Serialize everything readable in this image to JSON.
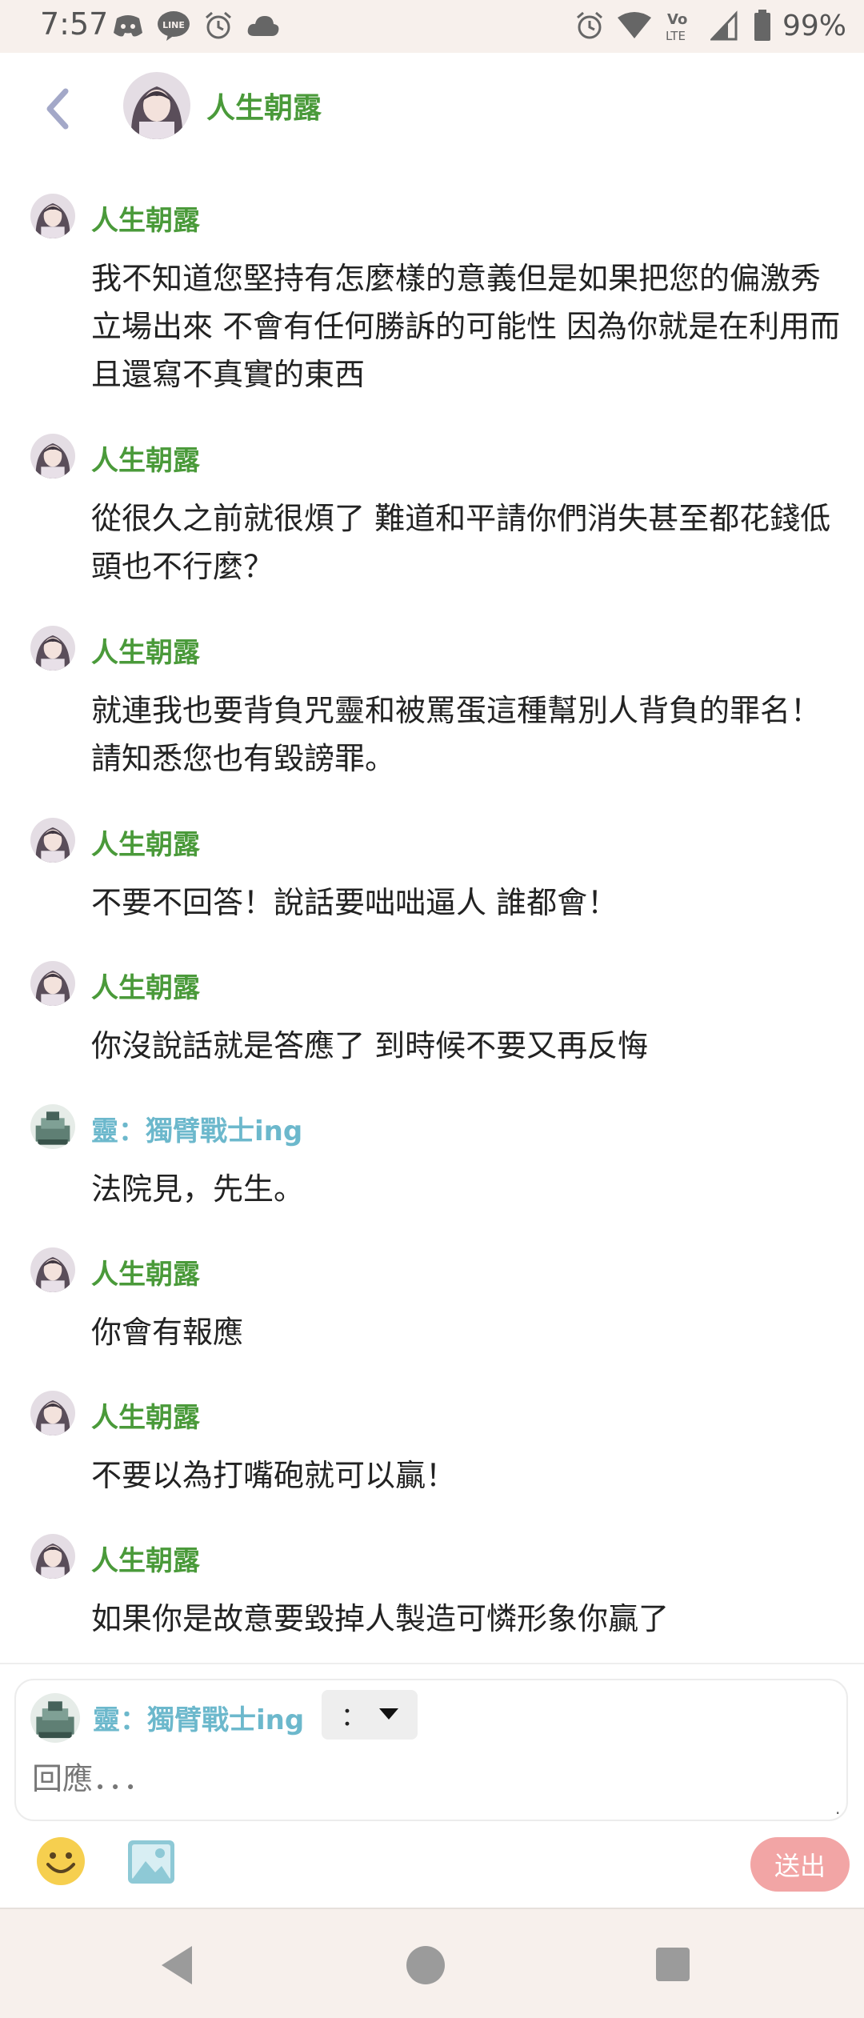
{
  "status_bar": {
    "time": "7:57",
    "battery": "99%",
    "icons_left": [
      "discord-icon",
      "line-icon",
      "alarm-icon",
      "cloud-icon"
    ],
    "icons_right": [
      "alarm-icon",
      "wifi-icon",
      "volte-icon",
      "signal-icon",
      "battery-icon"
    ]
  },
  "header": {
    "title": "人生朝露",
    "avatar": "anime-girl-avatar"
  },
  "messages": [
    {
      "author": "人生朝露",
      "author_color": "#4a9a3a",
      "avatar": "anime-girl-avatar",
      "text": "我不知道您堅持有怎麼樣的意義但是如果把您的偏激秀立場出來 不會有任何勝訴的可能性 因為你就是在利用而且還寫不真實的東西"
    },
    {
      "author": "人生朝露",
      "author_color": "#4a9a3a",
      "avatar": "anime-girl-avatar",
      "text": "從很久之前就很煩了 難道和平請你們消失甚至都花錢低頭也不行麼？"
    },
    {
      "author": "人生朝露",
      "author_color": "#4a9a3a",
      "avatar": "anime-girl-avatar",
      "text": "就連我也要背負咒靈和被罵蛋這種幫別人背負的罪名！請知悉您也有毀謗罪。"
    },
    {
      "author": "人生朝露",
      "author_color": "#4a9a3a",
      "avatar": "anime-girl-avatar",
      "text": "不要不回答！說話要咄咄逼人 誰都會！"
    },
    {
      "author": "人生朝露",
      "author_color": "#4a9a3a",
      "avatar": "anime-girl-avatar",
      "text": "你沒說話就是答應了 到時候不要又再反悔"
    },
    {
      "author": "靈：獨臂戰士ing",
      "author_color": "#6cb8cc",
      "avatar": "pixel-warrior-avatar",
      "text": "法院見，先生。"
    },
    {
      "author": "人生朝露",
      "author_color": "#4a9a3a",
      "avatar": "anime-girl-avatar",
      "text": "你會有報應"
    },
    {
      "author": "人生朝露",
      "author_color": "#4a9a3a",
      "avatar": "anime-girl-avatar",
      "text": "不要以為打嘴砲就可以贏！"
    },
    {
      "author": "人生朝露",
      "author_color": "#4a9a3a",
      "avatar": "anime-girl-avatar",
      "text": "如果你是故意要毀掉人製造可憐形象你贏了"
    }
  ],
  "composer": {
    "identity_name": "靈：獨臂戰士ing",
    "dropdown_label": "：",
    "placeholder": "回應．．．",
    "send_label": "送出",
    "send_color": "#f2a5a5"
  },
  "colors": {
    "accent_green": "#4a9a3a",
    "accent_blue": "#6cb8cc",
    "back_arrow": "#a3a8c8"
  }
}
